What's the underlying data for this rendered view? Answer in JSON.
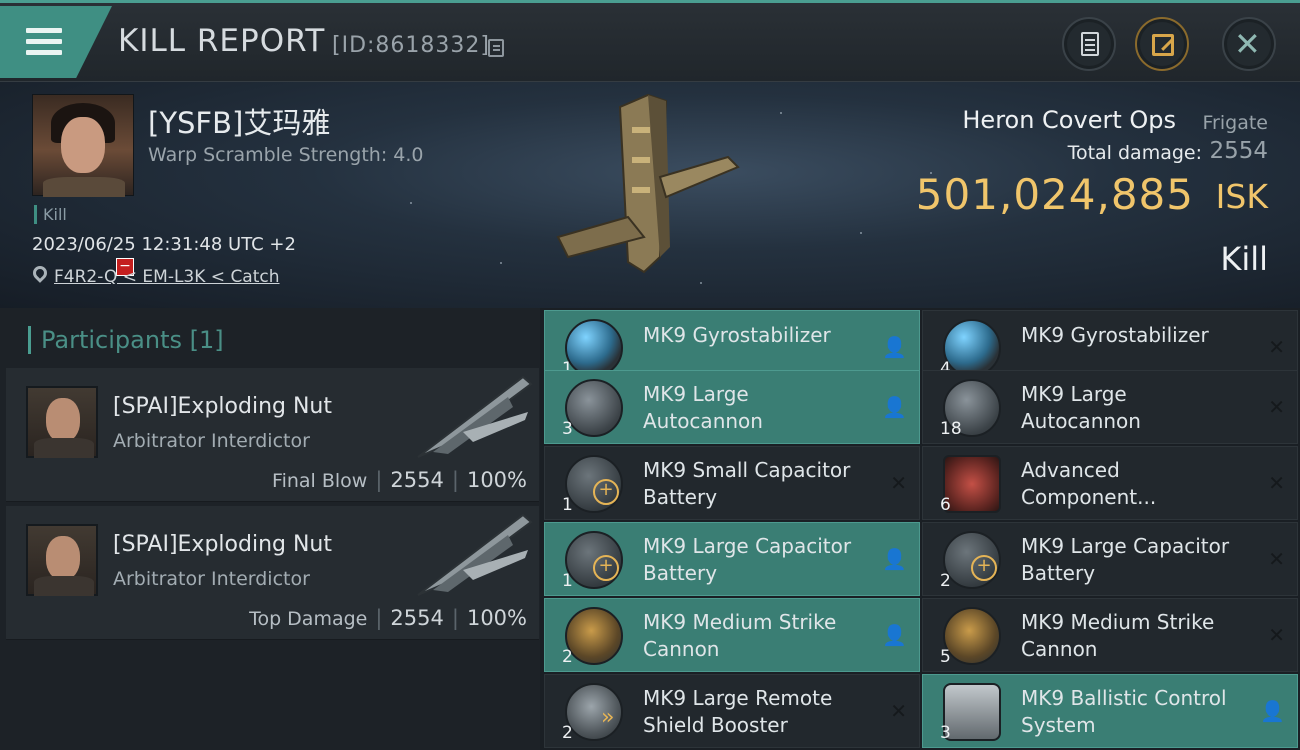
{
  "header": {
    "title": "KILL REPORT",
    "id_text": "[ID:8618332]"
  },
  "victim": {
    "name": "[YSFB]艾玛雅",
    "warp_scramble": "Warp Scramble Strength: 4.0",
    "kill_tag": "Kill",
    "datetime": "2023/06/25 12:31:48 UTC +2",
    "location": "F4R2-Q < EM-L3K < Catch",
    "ship_name": "Heron Covert Ops",
    "ship_class": "Frigate",
    "total_damage_label": "Total damage:",
    "total_damage": "2554",
    "isk_value": "501,024,885",
    "isk_unit": "ISK",
    "result": "Kill"
  },
  "participants": {
    "title": "Participants [1]",
    "items": [
      {
        "name": "[SPAI]Exploding Nut",
        "ship": "Arbitrator Interdictor",
        "label": "Final Blow",
        "damage": "2554",
        "percent": "100%"
      },
      {
        "name": "[SPAI]Exploding Nut",
        "ship": "Arbitrator Interdictor",
        "label": "Top Damage",
        "damage": "2554",
        "percent": "100%"
      }
    ]
  },
  "modules": [
    {
      "name": "MK9 Gyrostabilizer",
      "qty": "1",
      "status": "dropped",
      "icon": "gyrostabilizer-icon"
    },
    {
      "name": "MK9 Gyrostabilizer",
      "qty": "4",
      "status": "destroyed",
      "icon": "gyrostabilizer-icon"
    },
    {
      "name": "MK9 Large Autocannon",
      "qty": "3",
      "status": "dropped",
      "icon": "autocannon-icon"
    },
    {
      "name": "MK9 Large Autocannon",
      "qty": "18",
      "status": "destroyed",
      "icon": "autocannon-icon"
    },
    {
      "name": "MK9 Small Capacitor Battery",
      "qty": "1",
      "status": "destroyed",
      "icon": "capacitor-battery-icon"
    },
    {
      "name": "Advanced Component...",
      "qty": "6",
      "status": "destroyed",
      "icon": "component-cube-icon"
    },
    {
      "name": "MK9 Large Capacitor Battery",
      "qty": "1",
      "status": "dropped",
      "icon": "capacitor-battery-icon"
    },
    {
      "name": "MK9 Large Capacitor Battery",
      "qty": "2",
      "status": "destroyed",
      "icon": "capacitor-battery-icon"
    },
    {
      "name": "MK9 Medium Strike Cannon",
      "qty": "2",
      "status": "dropped",
      "icon": "strike-cannon-icon"
    },
    {
      "name": "MK9 Medium Strike Cannon",
      "qty": "5",
      "status": "destroyed",
      "icon": "strike-cannon-icon"
    },
    {
      "name": "MK9 Large Remote Shield Booster",
      "qty": "2",
      "status": "destroyed",
      "icon": "shield-booster-icon"
    },
    {
      "name": "MK9 Ballistic Control System",
      "qty": "3",
      "status": "dropped",
      "icon": "ballistic-control-icon"
    }
  ],
  "colors": {
    "accent": "#3f8f83",
    "isk": "#f0c56b",
    "dropped_row": "#3a7e74",
    "destroyed_row": "#22282d"
  }
}
